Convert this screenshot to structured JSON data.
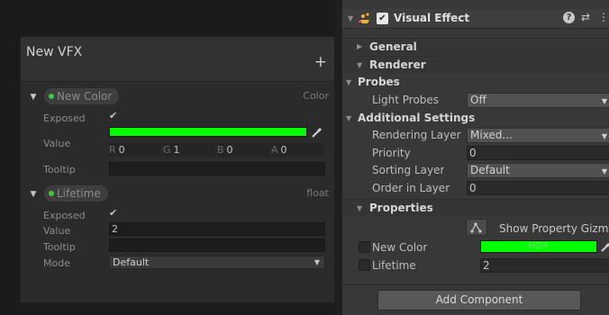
{
  "blackboard": {
    "title": "New VFX",
    "add_label": "+",
    "properties": [
      {
        "name": "New Color",
        "type": "Color",
        "labels": [
          "Exposed",
          "Value",
          "Tooltip"
        ],
        "exposed": true,
        "color_hex": "#00ff00",
        "rgba": [
          {
            "k": "R",
            "v": "0"
          },
          {
            "k": "G",
            "v": "1"
          },
          {
            "k": "B",
            "v": "0"
          },
          {
            "k": "A",
            "v": "0"
          }
        ],
        "tooltip": ""
      },
      {
        "name": "Lifetime",
        "type": "float",
        "labels": [
          "Exposed",
          "Value",
          "Tooltip",
          "Mode"
        ],
        "exposed": true,
        "value": "2",
        "tooltip": "",
        "mode": "Default"
      }
    ]
  },
  "inspector": {
    "component_title": "Visual Effect",
    "component_enabled": true,
    "sections": {
      "general": "General",
      "renderer": "Renderer",
      "probes": "Probes",
      "additional": "Additional Settings",
      "properties": "Properties"
    },
    "light_probes": {
      "label": "Light Probes",
      "value": "Off"
    },
    "additional_rows": [
      {
        "label": "Rendering Layer M",
        "value": "Mixed...",
        "kind": "select"
      },
      {
        "label": "Priority",
        "value": "0",
        "kind": "field"
      },
      {
        "label": "Sorting Layer",
        "value": "Default",
        "kind": "select"
      },
      {
        "label": "Order in Layer",
        "value": "0",
        "kind": "field"
      }
    ],
    "show_gizmos_label": "Show Property Gizmos",
    "exposed_props": [
      {
        "label": "New Color",
        "swatch_hex": "#00ff00",
        "overlay_text": "HDR"
      },
      {
        "label": "Lifetime",
        "value": "2"
      }
    ],
    "add_component_label": "Add Component"
  },
  "colors": {
    "accent_green": "#00ff00",
    "panel_dark": "#2b2b2b",
    "inspector_bg": "#383838",
    "component_icon": "#f0b030"
  }
}
